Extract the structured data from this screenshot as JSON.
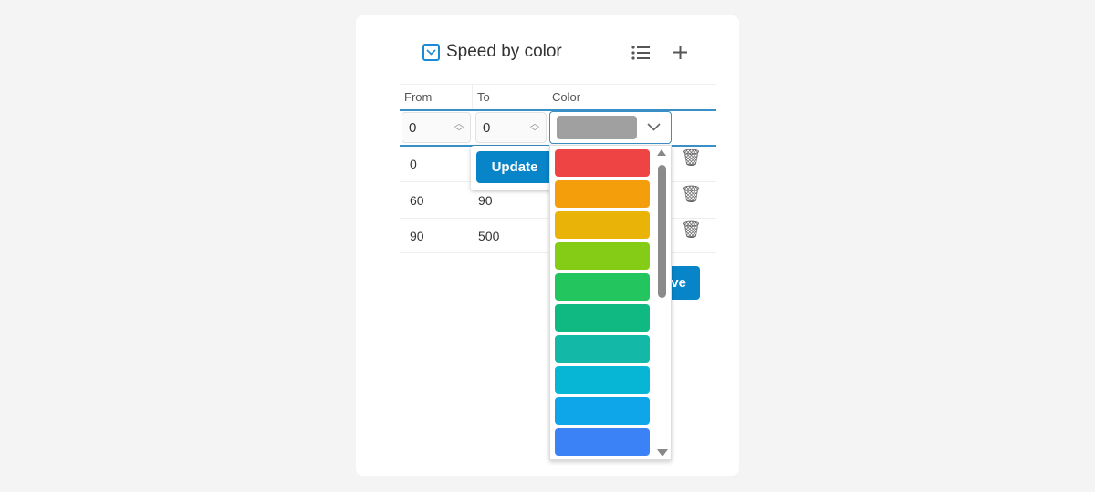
{
  "title": "Speed by color",
  "icons": {
    "collapse": "chevron-down-square-icon",
    "list": "list-icon",
    "add": "plus-icon",
    "delete": "trash-icon"
  },
  "columns": [
    "From",
    "To",
    "Color"
  ],
  "edit_row": {
    "from": "0",
    "to": "0",
    "color": "#a0a0a0"
  },
  "update_label": "Update",
  "save_label": "Save",
  "rows": [
    {
      "from": "0",
      "to": ""
    },
    {
      "from": "60",
      "to": "90"
    },
    {
      "from": "90",
      "to": "500"
    }
  ],
  "palette": [
    "#ef4444",
    "#f59e0b",
    "#eab308",
    "#84cc16",
    "#22c55e",
    "#10b981",
    "#14b8a6",
    "#06b6d4",
    "#0ea5e9",
    "#3b82f6"
  ],
  "accent": "#0884c8"
}
